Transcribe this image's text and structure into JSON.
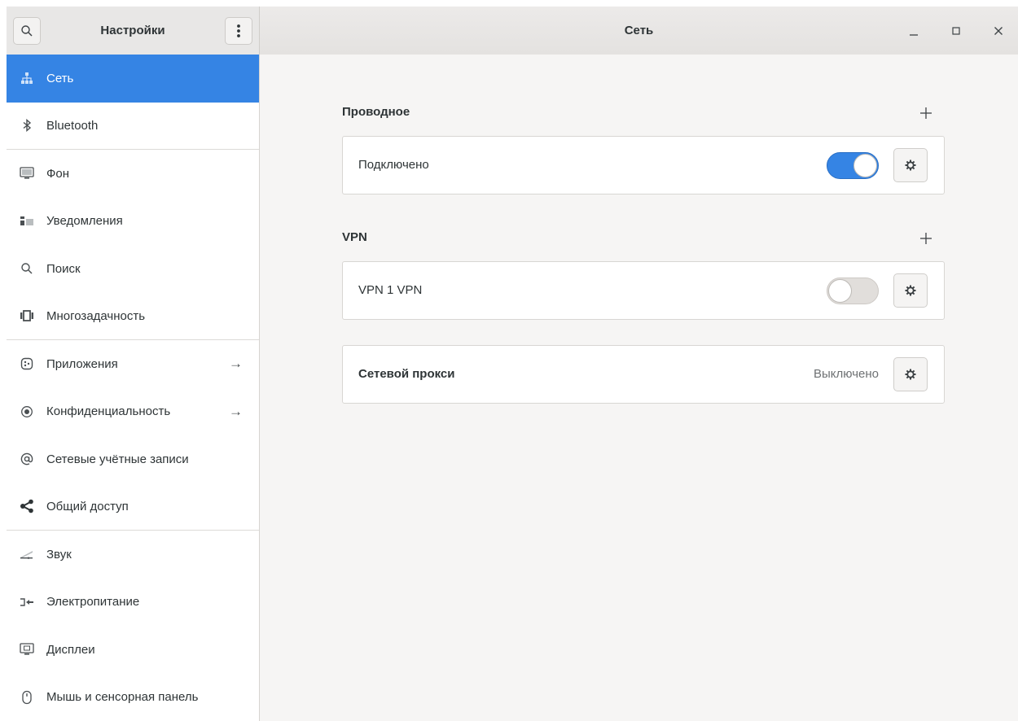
{
  "header": {
    "sidebar_title": "Настройки",
    "window_title": "Сеть",
    "search_icon": "search-icon",
    "menu_icon": "vertical-dots-icon"
  },
  "sidebar": {
    "items": [
      {
        "label": "Сеть",
        "icon": "network-icon",
        "active": true
      },
      {
        "label": "Bluetooth",
        "icon": "bluetooth-icon"
      },
      {
        "label": "Фон",
        "icon": "background-icon"
      },
      {
        "label": "Уведомления",
        "icon": "notifications-icon"
      },
      {
        "label": "Поиск",
        "icon": "search-icon"
      },
      {
        "label": "Многозадачность",
        "icon": "multitasking-icon"
      },
      {
        "label": "Приложения",
        "icon": "apps-icon",
        "arrow": "→"
      },
      {
        "label": "Конфиденциальность",
        "icon": "privacy-icon",
        "arrow": "→"
      },
      {
        "label": "Сетевые учётные записи",
        "icon": "at-sign-icon"
      },
      {
        "label": "Общий доступ",
        "icon": "share-icon"
      },
      {
        "label": "Звук",
        "icon": "sound-icon"
      },
      {
        "label": "Электропитание",
        "icon": "power-icon"
      },
      {
        "label": "Дисплеи",
        "icon": "display-icon"
      },
      {
        "label": "Мышь и сенсорная панель",
        "icon": "mouse-icon"
      }
    ]
  },
  "main": {
    "wired": {
      "title": "Проводное",
      "connection_label": "Подключено",
      "toggle_on": true
    },
    "vpn": {
      "title": "VPN",
      "connection_label": "VPN 1 VPN",
      "toggle_on": false
    },
    "proxy": {
      "label": "Сетевой прокси",
      "status": "Выключено"
    }
  },
  "colors": {
    "accent": "#3584e4",
    "window_bg": "#f6f5f4",
    "sidebar_bg": "#ffffff"
  }
}
